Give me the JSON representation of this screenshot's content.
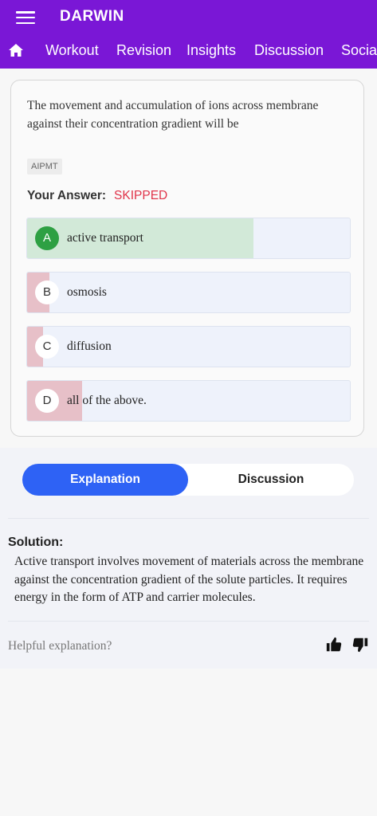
{
  "header": {
    "title": "DARWIN",
    "tabs": [
      "Workout",
      "Revision",
      "Insights",
      "Discussion",
      "Social"
    ],
    "color": "#7a17d6"
  },
  "question": {
    "text": "The movement and accumulation of ions across membrane against their concentration gradient will be",
    "tag": "AIPMT",
    "your_answer_label": "Your Answer:",
    "your_answer_value": "SKIPPED",
    "options": [
      {
        "letter": "A",
        "text": "active transport",
        "correct": true,
        "share": 0.7
      },
      {
        "letter": "B",
        "text": "osmosis",
        "correct": false,
        "share": 0.07
      },
      {
        "letter": "C",
        "text": "diffusion",
        "correct": false,
        "share": 0.05
      },
      {
        "letter": "D",
        "text": "all of the above.",
        "correct": false,
        "share": 0.17
      }
    ]
  },
  "explanation": {
    "tabs": [
      "Explanation",
      "Discussion"
    ],
    "active_tab": "Explanation",
    "solution_label": "Solution:",
    "solution_text": "Active transport involves movement of materials across the membrane against the concentration gradient of the solute particles. It requires energy in the form of ATP and carrier molecules.",
    "helpful_prompt": "Helpful explanation?",
    "icons": [
      "thumbs-up-icon",
      "thumbs-down-icon"
    ]
  },
  "colors": {
    "correct_fill": "#d2e9d8",
    "wrong_fill": "#e7c0c8",
    "option_bg": "#eef2fb",
    "skipped": "#e0344a",
    "accent": "#2e62f5"
  }
}
